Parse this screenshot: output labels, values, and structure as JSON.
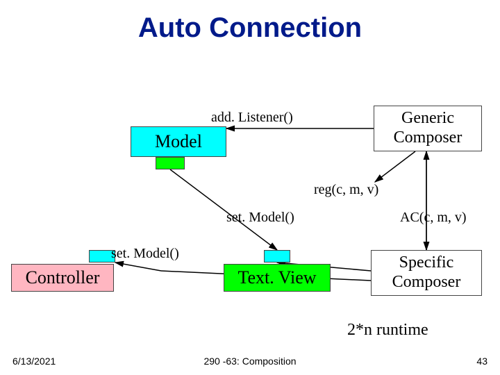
{
  "title": "Auto Connection",
  "boxes": {
    "model": "Model",
    "generic_l1": "Generic",
    "generic_l2": "Composer",
    "controller": "Controller",
    "textview": "Text. View",
    "specific_l1": "Specific",
    "specific_l2": "Composer"
  },
  "labels": {
    "addListener": "add. Listener()",
    "reg": "reg(c, m, v)",
    "setModel_top": "set. Model()",
    "setModel_left": "set. Model()",
    "ac": "AC(c, m, v)",
    "runtime": "2*n runtime"
  },
  "footer": {
    "date": "6/13/2021",
    "center": "290 -63: Composition",
    "page": "43"
  }
}
